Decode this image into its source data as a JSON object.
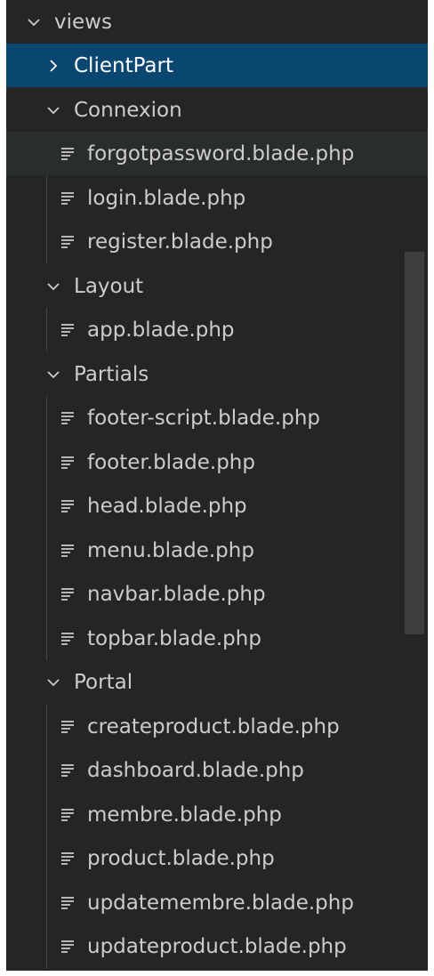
{
  "explorer": {
    "root": {
      "label": "views",
      "icon": "chevron-down-icon"
    },
    "client_part": {
      "label": "ClientPart",
      "icon": "chevron-right-icon"
    },
    "connexion": {
      "label": "Connexion",
      "icon": "chevron-down-icon",
      "files": [
        "forgotpassword.blade.php",
        "login.blade.php",
        "register.blade.php"
      ]
    },
    "layout": {
      "label": "Layout",
      "icon": "chevron-down-icon",
      "files": [
        "app.blade.php"
      ]
    },
    "partials": {
      "label": "Partials",
      "icon": "chevron-down-icon",
      "files": [
        "footer-script.blade.php",
        "footer.blade.php",
        "head.blade.php",
        "menu.blade.php",
        "navbar.blade.php",
        "topbar.blade.php"
      ]
    },
    "portal": {
      "label": "Portal",
      "icon": "chevron-down-icon",
      "files": [
        "createproduct.blade.php",
        "dashboard.blade.php",
        "membre.blade.php",
        "product.blade.php",
        "updatemembre.blade.php",
        "updateproduct.blade.php"
      ]
    },
    "file_icon": "text-file-icon",
    "colors": {
      "background": "#252526",
      "selected": "#094771",
      "hover": "#2a2d2e",
      "text": "#cccccc"
    }
  }
}
